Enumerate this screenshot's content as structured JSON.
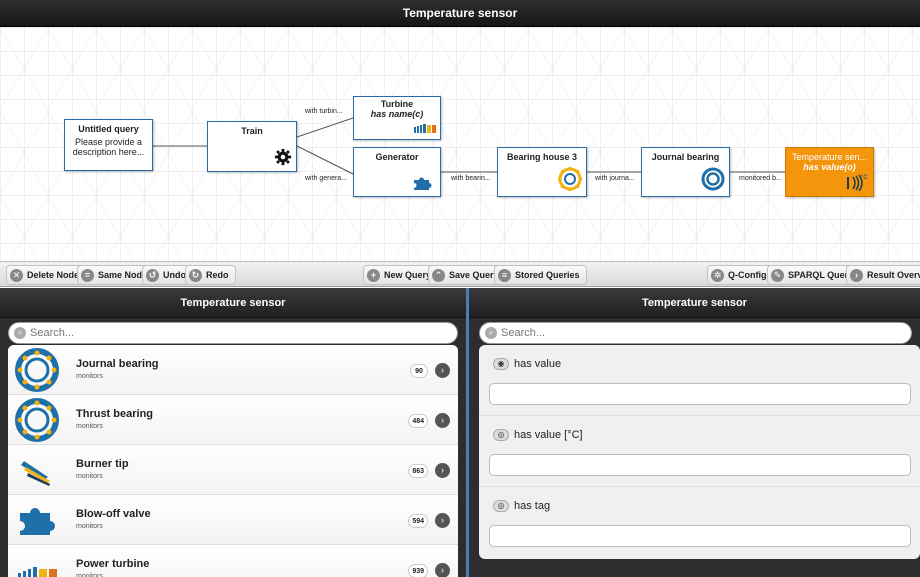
{
  "window": {
    "title": "Temperature sensor"
  },
  "graph": {
    "nodes": [
      {
        "id": "untitled",
        "title": "Untitled query",
        "description": "Please provide a description here..."
      },
      {
        "id": "train",
        "title": "Train",
        "icon": "gear-icon"
      },
      {
        "id": "turbine",
        "title": "Turbine",
        "subtitle": "has name(c)",
        "icon": "turbine-icon"
      },
      {
        "id": "generator",
        "title": "Generator",
        "icon": "puzzle-icon"
      },
      {
        "id": "bearinghouse",
        "title": "Bearing house 3",
        "icon": "bearing-house-icon"
      },
      {
        "id": "journal",
        "title": "Journal bearing",
        "icon": "bearing-icon"
      },
      {
        "id": "tempsensor",
        "title": "Temperature sen...",
        "subtitle": "has value(o)",
        "icon": "sensor-icon",
        "selected": true
      }
    ],
    "edges": [
      {
        "label": "with turbin..."
      },
      {
        "label": "with genera..."
      },
      {
        "label": "with bearin..."
      },
      {
        "label": "with journa..."
      },
      {
        "label": "monitored b..."
      }
    ]
  },
  "toolbar": {
    "delete_node": "Delete Node",
    "same_node": "Same Node",
    "undo": "Undo",
    "redo": "Redo",
    "new_query": "New Query",
    "save_query": "Save Query",
    "stored_queries": "Stored Queries",
    "qconfig": "Q-Config",
    "sparql_query": "SPARQL Query",
    "result_overview": "Result Overview"
  },
  "left_panel": {
    "title": "Temperature sensor",
    "search_placeholder": "Search...",
    "items": [
      {
        "name": "Journal bearing",
        "relation": "monitors",
        "count": "90",
        "icon": "bearing-icon"
      },
      {
        "name": "Thrust bearing",
        "relation": "monitors",
        "count": "484",
        "icon": "bearing-icon"
      },
      {
        "name": "Burner tip",
        "relation": "monitors",
        "count": "863",
        "icon": "burner-tip-icon"
      },
      {
        "name": "Blow-off valve",
        "relation": "monitors",
        "count": "594",
        "icon": "puzzle-icon"
      },
      {
        "name": "Power turbine",
        "relation": "monitors",
        "count": "939",
        "icon": "turbine-icon"
      }
    ]
  },
  "right_panel": {
    "title": "Temperature sensor",
    "search_placeholder": "Search...",
    "properties": [
      {
        "label": "has value",
        "value": "",
        "visibility": "eye-icon"
      },
      {
        "label": "has value [°C]",
        "value": "",
        "visibility": "eye-hidden-icon"
      },
      {
        "label": "has tag",
        "value": "",
        "visibility": "eye-hidden-icon"
      }
    ]
  },
  "colors": {
    "accent": "#f4960b",
    "node_border": "#2a6aa8",
    "bearing_blue": "#1f6fa8",
    "bearing_yellow": "#f2b311"
  }
}
